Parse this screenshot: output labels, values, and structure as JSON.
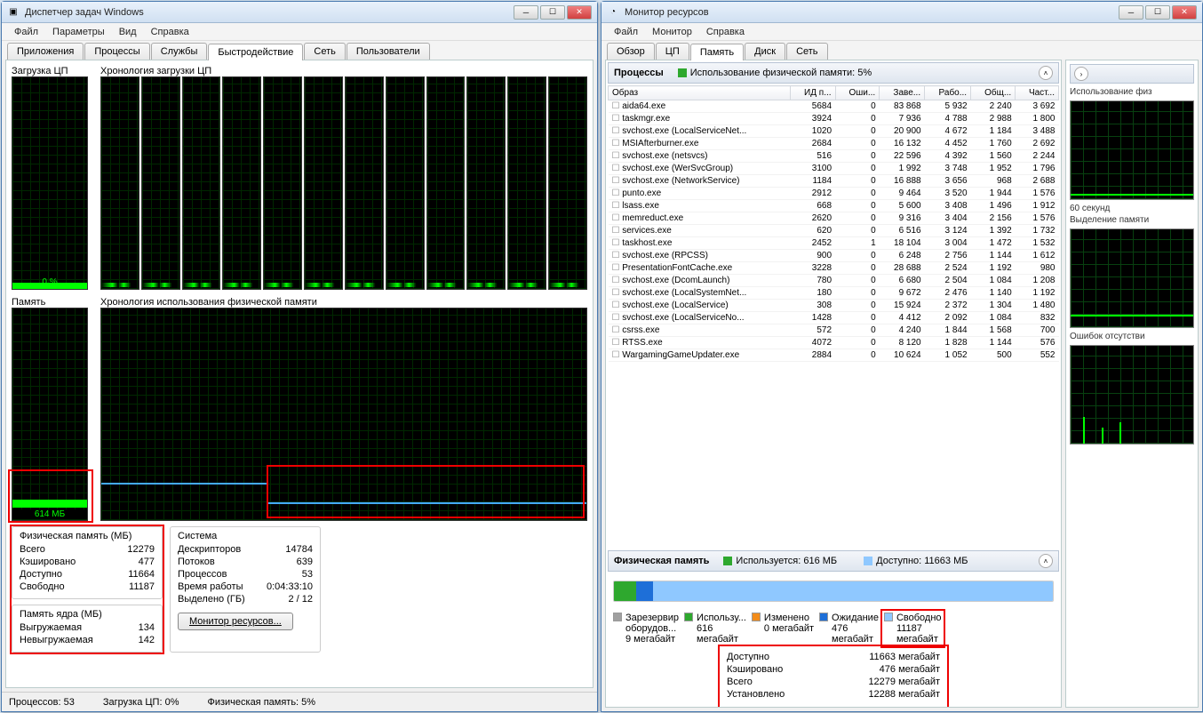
{
  "tm": {
    "title": "Диспетчер задач Windows",
    "menu": [
      "Файл",
      "Параметры",
      "Вид",
      "Справка"
    ],
    "tabs": [
      "Приложения",
      "Процессы",
      "Службы",
      "Быстродействие",
      "Сеть",
      "Пользователи"
    ],
    "active_tab": 3,
    "lbl_cpu": "Загрузка ЦП",
    "lbl_cpu_hist": "Хронология загрузки ЦП",
    "lbl_mem": "Память",
    "lbl_mem_hist": "Хронология использования физической памяти",
    "cpu_pct": "0 %",
    "mem_used": "614 МБ",
    "phys_mem": {
      "title": "Физическая память (МБ)",
      "rows": [
        [
          "Всего",
          "12279"
        ],
        [
          "Кэшировано",
          "477"
        ],
        [
          "Доступно",
          "11664"
        ],
        [
          "Свободно",
          "11187"
        ]
      ]
    },
    "kernel_mem": {
      "title": "Память ядра (МБ)",
      "rows": [
        [
          "Выгружаемая",
          "134"
        ],
        [
          "Невыгружаемая",
          "142"
        ]
      ]
    },
    "system": {
      "title": "Система",
      "rows": [
        [
          "Дескрипторов",
          "14784"
        ],
        [
          "Потоков",
          "639"
        ],
        [
          "Процессов",
          "53"
        ],
        [
          "Время работы",
          "0:04:33:10"
        ],
        [
          "Выделено (ГБ)",
          "2 / 12"
        ]
      ]
    },
    "monitor_btn": "Монитор ресурсов...",
    "status": {
      "proc": "Процессов: 53",
      "cpu": "Загрузка ЦП: 0%",
      "mem": "Физическая память: 5%"
    }
  },
  "rm": {
    "title": "Монитор ресурсов",
    "menu": [
      "Файл",
      "Монитор",
      "Справка"
    ],
    "tabs": [
      "Обзор",
      "ЦП",
      "Память",
      "Диск",
      "Сеть"
    ],
    "active_tab": 2,
    "proc_hdr": "Процессы",
    "proc_stat_label": "Использование физической памяти: 5%",
    "columns": [
      "Образ",
      "ИД п...",
      "Оши...",
      "Заве...",
      "Рабо...",
      "Общ...",
      "Част..."
    ],
    "rows": [
      [
        "aida64.exe",
        "5684",
        "0",
        "83 868",
        "5 932",
        "2 240",
        "3 692"
      ],
      [
        "taskmgr.exe",
        "3924",
        "0",
        "7 936",
        "4 788",
        "2 988",
        "1 800"
      ],
      [
        "svchost.exe (LocalServiceNet...",
        "1020",
        "0",
        "20 900",
        "4 672",
        "1 184",
        "3 488"
      ],
      [
        "MSIAfterburner.exe",
        "2684",
        "0",
        "16 132",
        "4 452",
        "1 760",
        "2 692"
      ],
      [
        "svchost.exe (netsvcs)",
        "516",
        "0",
        "22 596",
        "4 392",
        "1 560",
        "2 244"
      ],
      [
        "svchost.exe (WerSvcGroup)",
        "3100",
        "0",
        "1 992",
        "3 748",
        "1 952",
        "1 796"
      ],
      [
        "svchost.exe (NetworkService)",
        "1184",
        "0",
        "16 888",
        "3 656",
        "968",
        "2 688"
      ],
      [
        "punto.exe",
        "2912",
        "0",
        "9 464",
        "3 520",
        "1 944",
        "1 576"
      ],
      [
        "lsass.exe",
        "668",
        "0",
        "5 600",
        "3 408",
        "1 496",
        "1 912"
      ],
      [
        "memreduct.exe",
        "2620",
        "0",
        "9 316",
        "3 404",
        "2 156",
        "1 576"
      ],
      [
        "services.exe",
        "620",
        "0",
        "6 516",
        "3 124",
        "1 392",
        "1 732"
      ],
      [
        "taskhost.exe",
        "2452",
        "1",
        "18 104",
        "3 004",
        "1 472",
        "1 532"
      ],
      [
        "svchost.exe (RPCSS)",
        "900",
        "0",
        "6 248",
        "2 756",
        "1 144",
        "1 612"
      ],
      [
        "PresentationFontCache.exe",
        "3228",
        "0",
        "28 688",
        "2 524",
        "1 192",
        "980"
      ],
      [
        "svchost.exe (DcomLaunch)",
        "780",
        "0",
        "6 680",
        "2 504",
        "1 084",
        "1 208"
      ],
      [
        "svchost.exe (LocalSystemNet...",
        "180",
        "0",
        "9 672",
        "2 476",
        "1 140",
        "1 192"
      ],
      [
        "svchost.exe (LocalService)",
        "308",
        "0",
        "15 924",
        "2 372",
        "1 304",
        "1 480"
      ],
      [
        "svchost.exe (LocalServiceNo...",
        "1428",
        "0",
        "4 412",
        "2 092",
        "1 084",
        "832"
      ],
      [
        "csrss.exe",
        "572",
        "0",
        "4 240",
        "1 844",
        "1 568",
        "700"
      ],
      [
        "RTSS.exe",
        "4072",
        "0",
        "8 120",
        "1 828",
        "1 144",
        "576"
      ],
      [
        "WargamingGameUpdater.exe",
        "2884",
        "0",
        "10 624",
        "1 052",
        "500",
        "552"
      ]
    ],
    "mem_hdr": "Физическая память",
    "mem_used_label": "Используется: 616 МБ",
    "mem_avail_label": "Доступно: 11663 МБ",
    "legend": [
      {
        "c": "#a0a0a0",
        "t1": "Зарезервир",
        "t2": "оборудов...",
        "v": "9 мегабайт"
      },
      {
        "c": "#2ea82e",
        "t1": "Использу...",
        "t2": "616",
        "v": "мегабайт"
      },
      {
        "c": "#f28c1a",
        "t1": "Изменено",
        "t2": "0 мегабайт",
        "v": ""
      },
      {
        "c": "#1e6fd8",
        "t1": "Ожидание",
        "t2": "476",
        "v": "мегабайт"
      },
      {
        "c": "#8fc8ff",
        "t1": "Свободно",
        "t2": "11187",
        "v": "мегабайт"
      }
    ],
    "details": [
      [
        "Доступно",
        "11663 мегабайт"
      ],
      [
        "Кэшировано",
        "476 мегабайт"
      ],
      [
        "Всего",
        "12279 мегабайт"
      ],
      [
        "Установлено",
        "12288 мегабайт"
      ]
    ],
    "side": {
      "l1": "Использование физ",
      "sec60": "60 секунд",
      "l2": "Выделение памяти",
      "l3": "Ошибок отсутстви"
    }
  },
  "chart_data": {
    "task_manager": {
      "cpu_percent": 0,
      "mem_used_mb": 614,
      "mem_total_mb": 12279
    },
    "resource_monitor_memory_bar": {
      "type": "bar",
      "segments": [
        {
          "name": "Зарезервировано оборудованием",
          "value_mb": 9,
          "color": "#a0a0a0"
        },
        {
          "name": "Используется",
          "value_mb": 616,
          "color": "#2ea82e"
        },
        {
          "name": "Изменено",
          "value_mb": 0,
          "color": "#f28c1a"
        },
        {
          "name": "Ожидание",
          "value_mb": 476,
          "color": "#1e6fd8"
        },
        {
          "name": "Свободно",
          "value_mb": 11187,
          "color": "#8fc8ff"
        }
      ],
      "total_mb": 12288
    }
  }
}
